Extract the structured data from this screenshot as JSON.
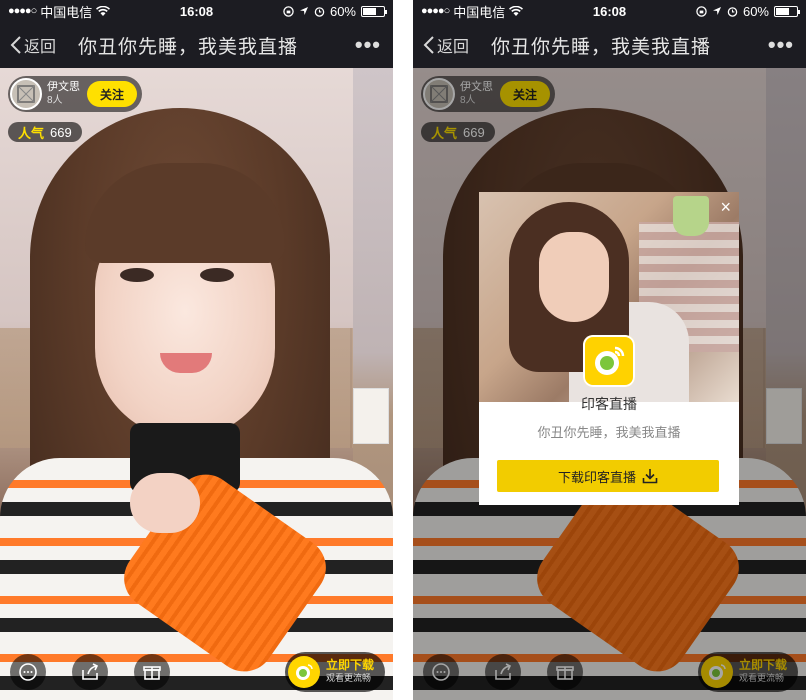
{
  "status": {
    "signal_dots": "●●●●○",
    "carrier": "中国电信",
    "time": "16:08",
    "battery": "60%",
    "battery_level": 0.6
  },
  "nav": {
    "back_label": "返回",
    "title": "你丑你先睡，我美我直播",
    "more_label": "•••"
  },
  "host": {
    "name": "伊文思",
    "count": "8人",
    "follow_label": "关注"
  },
  "popularity": {
    "label": "人气",
    "value": "669"
  },
  "download_pill": {
    "title": "立即下载",
    "subtitle": "观看更流畅"
  },
  "modal": {
    "close_label": "×",
    "app_name": "印客直播",
    "tagline": "你丑你先睡，我美我直播",
    "download_label": "下载印客直播"
  },
  "colors": {
    "accent": "#ffe000",
    "nav_bg": "#1c1c22",
    "download_button": "#f2cc00"
  }
}
